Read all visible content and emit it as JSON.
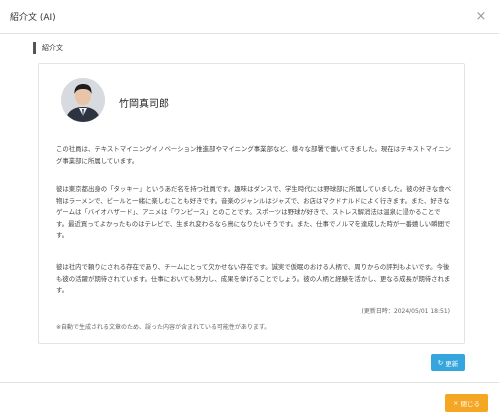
{
  "modal": {
    "title": "紹介文 (AI)",
    "close_glyph": "×"
  },
  "section": {
    "label": "紹介文"
  },
  "profile": {
    "name": "竹岡真司郎"
  },
  "intro": {
    "paragraph1": "この社員は、テキストマイニングイノベーション推進部やマイニング事業部など、様々な部署で働いてきました。現在はテキストマイニング事業部に所属しています。",
    "paragraph2": "彼は東京都出身の「タッキー」というあだ名を持つ社員です。趣味はダンスで、学生時代には野球部に所属していました。彼の好きな食べ物はラーメンで、ビールと一緒に楽しむことも好きです。音楽のジャンルはジャズで、お店はマクドナルドによく行きます。また、好きなゲームは「バイオハザード」、アニメは「ワンピース」とのことです。スポーツは野球が好きで、ストレス解消法は温泉に浸かることです。最近買ってよかったものはテレビで、生まれ変わるなら鳥になりたいそうです。また、仕事でノルマを達成した時が一番嬉しい瞬間です。",
    "paragraph3": "彼は社内で頼りにされる存在であり、チームにとって欠かせない存在です。誠実で仮眠のおける人柄で、周りからの評判もよいです。今後も彼の活躍が期待されています。仕事においても努力し、成果を挙げることでしょう。彼の人柄と経験を活かし、更なる成長が期待されます。",
    "updated_at": "(更新日時：2024/05/01 18:51)",
    "notice": "※自動で生成される文章のため、誤った内容が含まれている可能性があります。"
  },
  "buttons": {
    "refresh_label": "更新",
    "refresh_icon": "↻",
    "close_label": "閉じる",
    "close_icon": "×"
  },
  "colors": {
    "refresh_button": "#35a5dd",
    "close_button": "#f5a623"
  }
}
